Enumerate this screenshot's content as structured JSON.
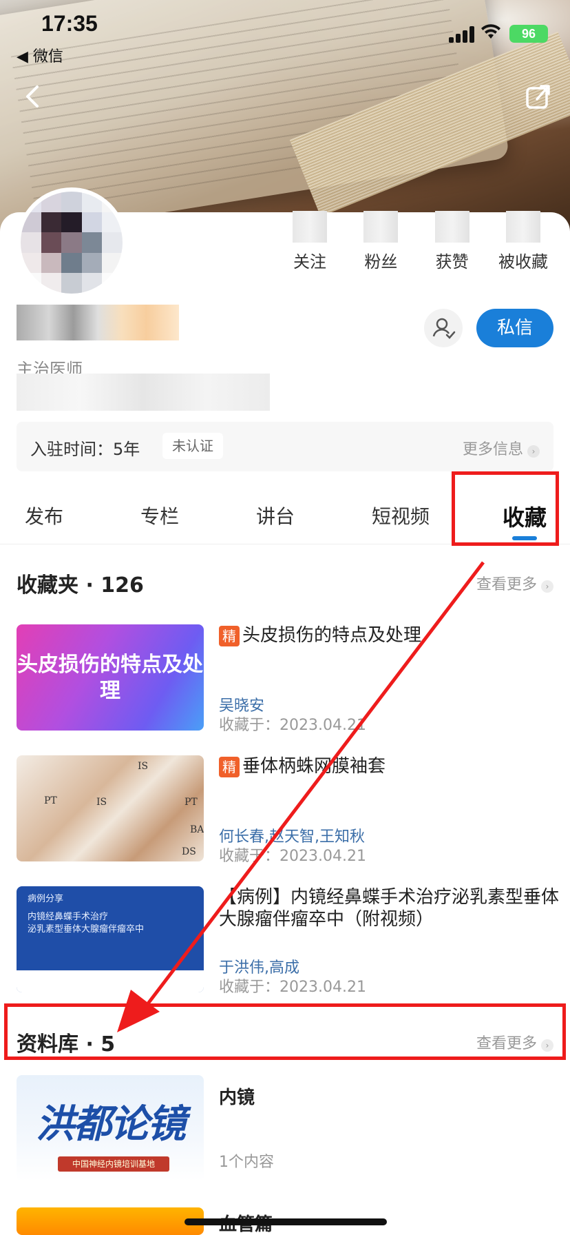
{
  "status": {
    "time": "17:35",
    "back_app": "◀ 微信",
    "battery": "96"
  },
  "stats": [
    {
      "label": "关注"
    },
    {
      "label": "粉丝"
    },
    {
      "label": "获赞"
    },
    {
      "label": "被收藏"
    }
  ],
  "profile": {
    "role": "主治医师",
    "message_button": "私信"
  },
  "info_bar": {
    "join_text": "入驻时间：5年",
    "cert_badge": "未认证",
    "more_info": "更多信息"
  },
  "tabs": [
    "发布",
    "专栏",
    "讲台",
    "短视频",
    "收藏"
  ],
  "favorites": {
    "title": "收藏夹 · 126",
    "see_more": "查看更多",
    "items": [
      {
        "badge": "精",
        "title": "头皮损伤的特点及处理",
        "thumb_text": "头皮损伤的特点及处理",
        "author": "吴晓安",
        "date": "收藏于：2023.04.21"
      },
      {
        "badge": "精",
        "title": "垂体柄蛛网膜袖套",
        "author": "何长春,赵天智,王知秋",
        "date": "收藏于：2023.04.21"
      },
      {
        "title": "【病例】内镜经鼻蝶手术治疗泌乳素型垂体大腺瘤伴瘤卒中（附视频）",
        "thumb_lines": [
          "病例分享",
          "内镜经鼻蝶手术治疗",
          "泌乳素型垂体大腺瘤伴瘤卒中"
        ],
        "author": "于洪伟,高成",
        "date": "收藏于：2023.04.21"
      }
    ]
  },
  "library": {
    "title": "资料库 · 5",
    "see_more": "查看更多",
    "items": [
      {
        "title": "内镜",
        "count": "1个内容",
        "thumb_text": "洪都论镜",
        "thumb_base": "中国神经内镜培训基地"
      },
      {
        "title": "血管篇"
      }
    ]
  },
  "colors": {
    "accent": "#1a7fd9",
    "highlight": "#ee1c1c",
    "badge": "#f0602a"
  }
}
